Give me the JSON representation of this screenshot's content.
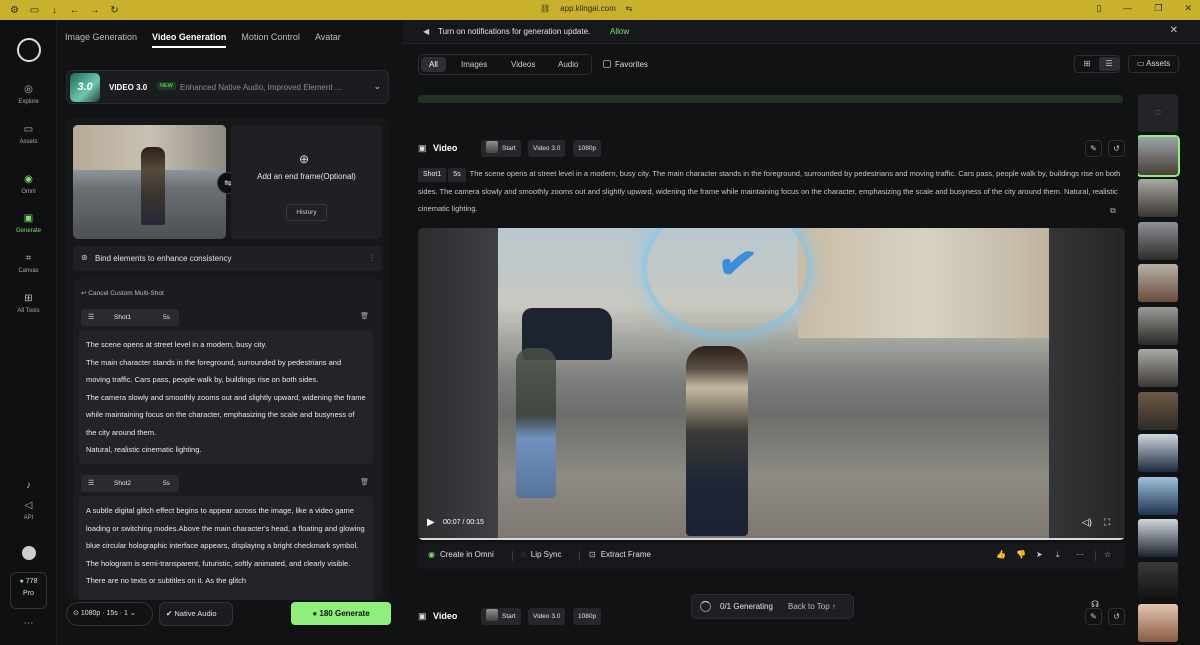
{
  "browser": {
    "url": "app.klingai.com"
  },
  "rail": {
    "items": [
      {
        "label": "Explore",
        "icon": "compass-icon"
      },
      {
        "label": "Assets",
        "icon": "folder-icon"
      },
      {
        "label": "Omni",
        "icon": "omni-icon"
      },
      {
        "label": "Generate",
        "icon": "generate-icon"
      },
      {
        "label": "Canvas",
        "icon": "canvas-icon"
      },
      {
        "label": "All Tools",
        "icon": "grid-icon"
      },
      {
        "label": "API",
        "icon": "megaphone-icon"
      }
    ],
    "credits": "778",
    "plan": "Pro"
  },
  "tabs": [
    "Image Generation",
    "Video Generation",
    "Motion Control",
    "Avatar"
  ],
  "model": {
    "thumb": "3.0",
    "name": "VIDEO 3.0",
    "badge": "NEW",
    "desc": "Enhanced Native Audio, Improved Element ..."
  },
  "frames": {
    "end_label": "Add an end frame(Optional)",
    "history": "History"
  },
  "bind": {
    "label": "Bind elements to enhance consistency"
  },
  "multishot": {
    "cancel": "Cancel Custom Multi-Shot",
    "shots": [
      {
        "name": "Shot1",
        "duration": "5s",
        "text": "The scene opens at street level in a modern, busy city.\nThe main character stands in the foreground, surrounded by pedestrians and moving traffic. Cars pass, people walk by, buildings rise on both sides.\nThe camera slowly and smoothly zooms out and slightly upward, widening the frame while maintaining focus on the character, emphasizing the scale and busyness of the city around them.\nNatural, realistic cinematic lighting."
      },
      {
        "name": "Shot2",
        "duration": "5s",
        "text": "A subtle digital glitch effect begins to appear across the image, like a video game loading or switching modes.Above the main character's head, a floating and glowing blue circular holographic interface appears, displaying a bright checkmark symbol. The hologram is semi-transparent, futuristic, softly animated, and clearly visible. There are no texts or subtitles on it. As the glitch"
      }
    ]
  },
  "bottom": {
    "settings": "1080p · 15s · 1",
    "audio": "Native Audio",
    "generate_cost": "180",
    "generate_label": "Generate"
  },
  "notif": {
    "text": "Turn on notifications for generation update.",
    "allow": "Allow"
  },
  "filters": {
    "items": [
      "All",
      "Images",
      "Videos",
      "Audio"
    ],
    "favorites": "Favorites",
    "assets": "Assets"
  },
  "video": {
    "title": "Video",
    "chips": [
      "Start",
      "Video 3.0",
      "1080p"
    ],
    "shot_chip": "Shot1",
    "shot_dur": "5s",
    "prompt": "The scene opens at street level in a modern, busy city. The main character stands in the foreground, surrounded by pedestrians and moving traffic. Cars pass, people walk by, buildings rise on both sides. The camera slowly and smoothly zooms out and slightly upward, widening the frame while maintaining focus on the character, emphasizing the scale and busyness of the city around them. Natural, realistic cinematic lighting.",
    "time": "00:07 / 00:15",
    "playback_progress": 0.47
  },
  "actions": {
    "create_omni": "Create in Omni",
    "lip_sync": "Lip Sync",
    "extract_frame": "Extract Frame"
  },
  "status": {
    "generating": "0/1 Generating",
    "back_top": "Back to Top"
  },
  "video2": {
    "title": "Video",
    "chips": [
      "Start",
      "Video 3.0",
      "1080p"
    ]
  },
  "colors": {
    "accent": "#8ef07a",
    "allow": "#7be26b"
  }
}
